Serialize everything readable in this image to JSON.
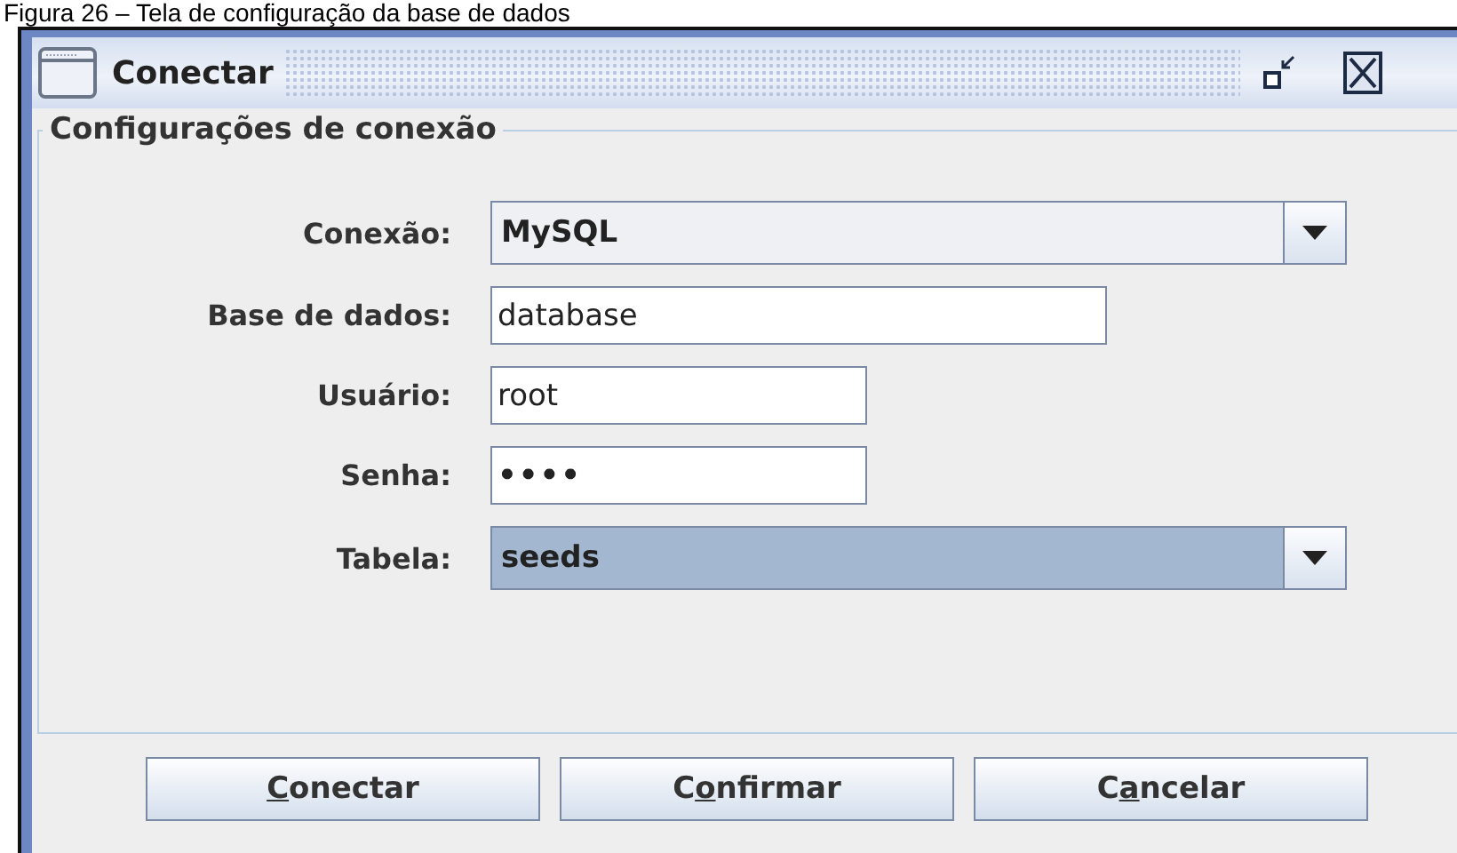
{
  "caption": "Figura 26 – Tela de configuração da base de dados",
  "window": {
    "title": "Conectar"
  },
  "group": {
    "title": "Configurações de conexão",
    "fields": [
      {
        "kind": "combo",
        "label": "Conexão:",
        "value": "MySQL",
        "selected": false
      },
      {
        "kind": "text",
        "label": "Base de dados:",
        "value": "database"
      },
      {
        "kind": "text",
        "label": "Usuário:",
        "value": "root"
      },
      {
        "kind": "password",
        "label": "Senha:",
        "value": "••••"
      },
      {
        "kind": "combo",
        "label": "Tabela:",
        "value": "seeds",
        "selected": true
      }
    ]
  },
  "buttons": [
    {
      "mnemonic": "C",
      "after": "onectar"
    },
    {
      "before": "C",
      "mnemonic": "o",
      "after": "nfirmar"
    },
    {
      "before": "C",
      "mnemonic": "a",
      "after": "ncelar"
    }
  ]
}
